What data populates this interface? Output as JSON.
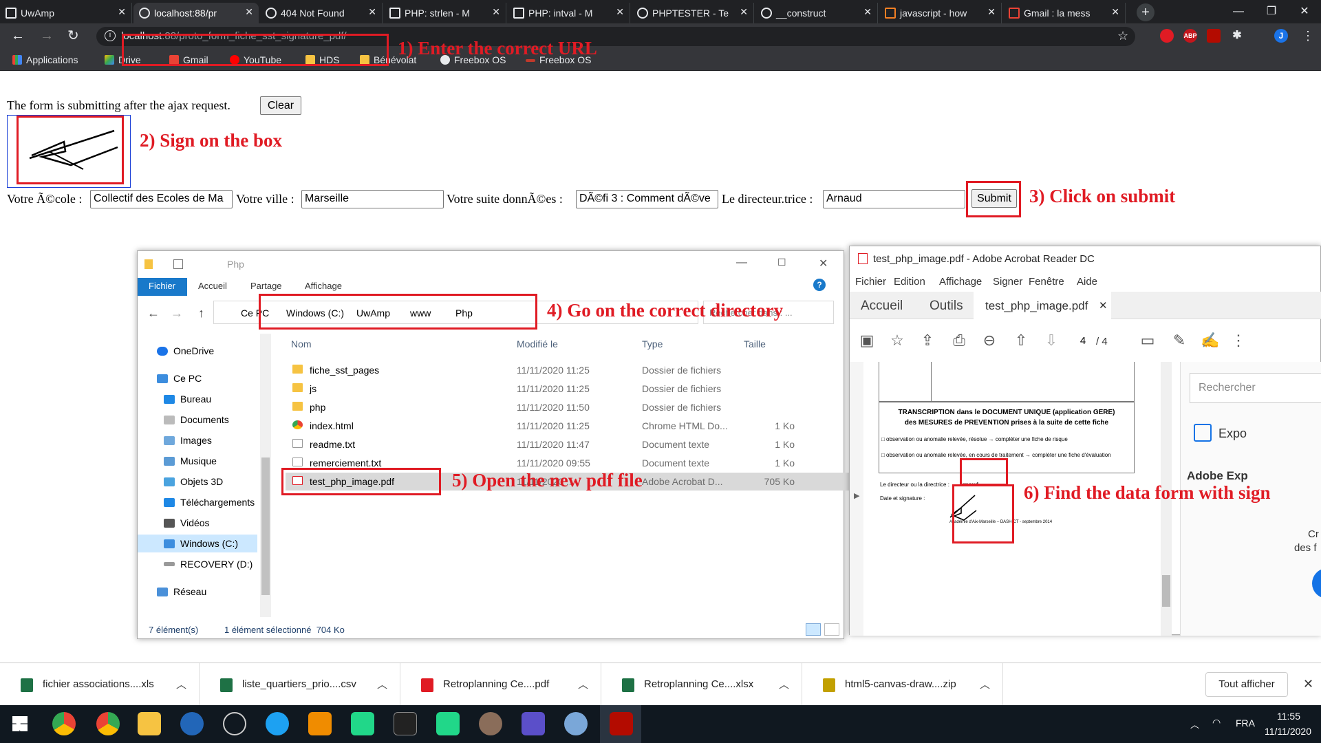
{
  "browser": {
    "tabs": [
      {
        "title": "UwAmp"
      },
      {
        "title": "localhost:88/pr"
      },
      {
        "title": "404 Not Found"
      },
      {
        "title": "PHP: strlen - M"
      },
      {
        "title": "PHP: intval - M"
      },
      {
        "title": "PHPTESTER - Te"
      },
      {
        "title": "__construct"
      },
      {
        "title": "javascript - how"
      },
      {
        "title": "Gmail : la mess"
      }
    ],
    "url_host": "localhost",
    "url_rest": ":88/proto_form_fiche_sst_signature_pdf/",
    "profile_initial": "J",
    "ext_abp": "ABP",
    "bookmarks": [
      {
        "label": "Applications"
      },
      {
        "label": "Drive"
      },
      {
        "label": "Gmail"
      },
      {
        "label": "YouTube"
      },
      {
        "label": "HDS"
      },
      {
        "label": "Bénévolat"
      },
      {
        "label": "Freebox OS"
      },
      {
        "label": "Freebox OS"
      }
    ]
  },
  "page": {
    "status_text": "The form is submitting after the ajax request.",
    "clear_label": "Clear",
    "label_ecole": "Votre Ã©cole :",
    "value_ecole": "Collectif des Ecoles de Ma",
    "label_ville": "Votre ville :",
    "value_ville": "Marseille",
    "label_suite": "Votre suite donnÃ©es :",
    "value_suite": "DÃ©fi 3 : Comment dÃ©ve",
    "label_directeur": "Le directeur.trice :",
    "value_directeur": "Arnaud",
    "submit_label": "Submit"
  },
  "annotations": {
    "step1": "1) Enter the correct URL",
    "step2": "2) Sign on the box",
    "step3": "3) Click on submit",
    "step4": "4) Go on the correct directory",
    "step5": "5) Open the new pdf file",
    "step6": "6) Find the data form with sign"
  },
  "explorer": {
    "title": "Php",
    "ribbon_tabs": [
      "Fichier",
      "Accueil",
      "Partage",
      "Affichage"
    ],
    "breadcrumb": [
      "Ce PC",
      "Windows (C:)",
      "UwAmp",
      "www",
      "Php"
    ],
    "search_placeholder": "Rechercher dans : ...",
    "nav": [
      {
        "label": "OneDrive"
      },
      {
        "label": "Ce PC"
      },
      {
        "label": "Bureau"
      },
      {
        "label": "Documents"
      },
      {
        "label": "Images"
      },
      {
        "label": "Musique"
      },
      {
        "label": "Objets 3D"
      },
      {
        "label": "Téléchargements"
      },
      {
        "label": "Vidéos"
      },
      {
        "label": "Windows (C:)"
      },
      {
        "label": "RECOVERY (D:)"
      },
      {
        "label": "Réseau"
      }
    ],
    "columns": {
      "name": "Nom",
      "modified": "Modifié le",
      "type": "Type",
      "size": "Taille"
    },
    "files": [
      {
        "name": "fiche_sst_pages",
        "modified": "11/11/2020 11:25",
        "type": "Dossier de fichiers",
        "size": ""
      },
      {
        "name": "js",
        "modified": "11/11/2020 11:25",
        "type": "Dossier de fichiers",
        "size": ""
      },
      {
        "name": "php",
        "modified": "11/11/2020 11:50",
        "type": "Dossier de fichiers",
        "size": ""
      },
      {
        "name": "index.html",
        "modified": "11/11/2020 11:25",
        "type": "Chrome HTML Do...",
        "size": "1 Ko"
      },
      {
        "name": "readme.txt",
        "modified": "11/11/2020 11:47",
        "type": "Document texte",
        "size": "1 Ko"
      },
      {
        "name": "remerciement.txt",
        "modified": "11/11/2020 09:55",
        "type": "Document texte",
        "size": "1 Ko"
      },
      {
        "name": "test_php_image.pdf",
        "modified": "11/11/2020 ...",
        "type": "Adobe Acrobat D...",
        "size": "705 Ko"
      }
    ],
    "status_count": "7 élément(s)",
    "status_selection": "1 élément sélectionné  704 Ko"
  },
  "acrobat": {
    "title": "test_php_image.pdf - Adobe Acrobat Reader DC",
    "menu": [
      "Fichier",
      "Edition",
      "Affichage",
      "Signer",
      "Fenêtre",
      "Aide"
    ],
    "tab_home": "Accueil",
    "tab_tools": "Outils",
    "tab_doc": "test_php_image.pdf",
    "page_current": "4",
    "page_total": "/ 4",
    "doc_heading_1": "TRANSCRIPTION dans le DOCUMENT UNIQUE (application GERE)",
    "doc_heading_2": "des MESURES de PREVENTION prises à la suite de cette fiche",
    "doc_check_1": "□ observation ou anomalie relevée, résolue → compléter une fiche de risque",
    "doc_check_2": "□ observation ou anomalie relevée, en cours de traitement → compléter une fiche d'évaluation",
    "doc_director_label": "Le directeur ou la directrice :",
    "doc_director_value": "Arnaud",
    "doc_date_label": "Date et signature :",
    "doc_footer": "Académie d'Aix-Marseille – DASH-CT - septembre 2014",
    "side_search": "Rechercher",
    "side_export": "Expo",
    "side_adobe": "Adobe Exp",
    "side_cr": "Cr",
    "side_des": "des f"
  },
  "downloads": {
    "items": [
      {
        "name": "fichier associations....xls",
        "color": "#1e7145"
      },
      {
        "name": "liste_quartiers_prio....csv",
        "color": "#1e7145"
      },
      {
        "name": "Retroplanning Ce....pdf",
        "color": "#e01b24"
      },
      {
        "name": "Retroplanning Ce....xlsx",
        "color": "#1e7145"
      },
      {
        "name": "html5-canvas-draw....zip",
        "color": "#c2a000"
      }
    ],
    "show_all": "Tout afficher"
  },
  "taskbar": {
    "lang": "FRA",
    "time": "11:55",
    "date": "11/11/2020"
  }
}
